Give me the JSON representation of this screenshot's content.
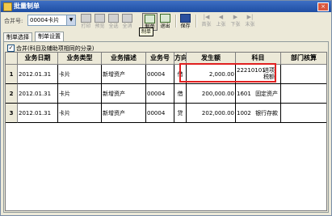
{
  "window": {
    "title": "批量制单",
    "close_label": "×"
  },
  "toolbar": {
    "combo_label": "合并号:",
    "combo_value": "00004卡片",
    "buttons": [
      {
        "label": "打印",
        "state": "disabled"
      },
      {
        "label": "预览",
        "state": "disabled"
      },
      {
        "label": "全选",
        "state": "disabled"
      },
      {
        "label": "全消",
        "state": "disabled"
      },
      {
        "label": "制单",
        "state": "active"
      },
      {
        "label": "退出",
        "state": "active"
      },
      {
        "label": "保存",
        "state": "active"
      },
      {
        "label": "首张",
        "state": "disabled"
      },
      {
        "label": "上张",
        "state": "disabled"
      },
      {
        "label": "下张",
        "state": "disabled"
      },
      {
        "label": "末张",
        "state": "disabled"
      }
    ],
    "tooltip": "制单"
  },
  "tabs": [
    {
      "label": "制单选择",
      "selected": false
    },
    {
      "label": "制单设置",
      "selected": true
    }
  ],
  "merge": {
    "checked": true,
    "label": "合并(科目及辅助项相同的分录)"
  },
  "table": {
    "headers": [
      "",
      "业务日期",
      "业务类型",
      "业务描述",
      "业务号",
      "方向",
      "发生额",
      "科目",
      "部门核算"
    ],
    "rows": [
      {
        "num": "1",
        "date": "2012.01.31",
        "type": "卡片",
        "desc": "新增资产",
        "no": "00004",
        "dir": "借",
        "amount": "2,000.00",
        "code": "22210101",
        "subject": "进项税额"
      },
      {
        "num": "2",
        "date": "2012.01.31",
        "type": "卡片",
        "desc": "新增资产",
        "no": "00004",
        "dir": "借",
        "amount": "200,000.00",
        "code": "1601",
        "subject": "固定资产"
      },
      {
        "num": "3",
        "date": "2012.01.31",
        "type": "卡片",
        "desc": "新增资产",
        "no": "00004",
        "dir": "贷",
        "amount": "202,000.00",
        "code": "1002",
        "subject": "银行存款"
      }
    ]
  },
  "colors": {
    "titlebar": "#1f4ea3",
    "highlight": "#e02020",
    "window_bg": "#ece9d8"
  }
}
